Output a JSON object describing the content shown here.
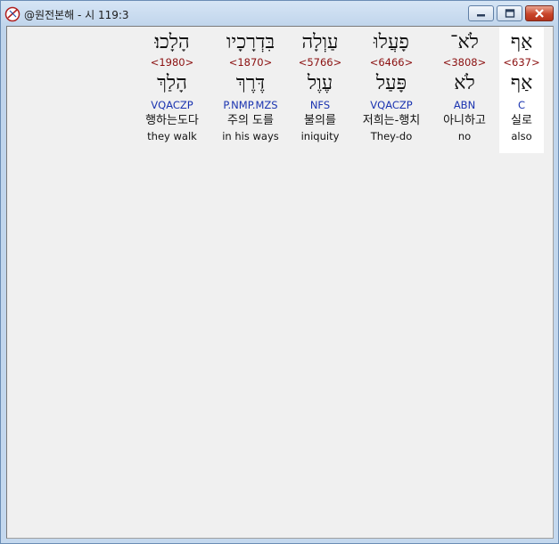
{
  "window": {
    "title": "@원전본해 - 시 119:3",
    "minimize_icon": "minimize-icon",
    "maximize_icon": "maximize-icon",
    "close_icon": "close-icon"
  },
  "words": [
    {
      "hebrew": "אַף",
      "strong": "<637>",
      "lemma": "אַף",
      "morph": "C",
      "korean": "실로",
      "english": "also",
      "selected": true
    },
    {
      "hebrew": "לֹא־",
      "strong": "<3808>",
      "lemma": "לֹא",
      "morph": "ABN",
      "korean": "아니하고",
      "english": "no",
      "selected": false
    },
    {
      "hebrew": "פָעֲלוּ",
      "strong": "<6466>",
      "lemma": "פָּעַל",
      "morph": "VQACZP",
      "korean": "저희는-행치",
      "english": "They-do",
      "selected": false
    },
    {
      "hebrew": "עַוְלָה",
      "strong": "<5766>",
      "lemma": "עֶוֶל",
      "morph": "NFS",
      "korean": "불의를",
      "english": "iniquity",
      "selected": false
    },
    {
      "hebrew": "בִּדְרָכָיו",
      "strong": "<1870>",
      "lemma": "דֶּרֶךְ",
      "morph": "P.NMP.MZS",
      "korean": "주의 도를",
      "english": "in his ways",
      "selected": false
    },
    {
      "hebrew": "הָלָכוּ׃",
      "strong": "<1980>",
      "lemma": "הָלַךְ",
      "morph": "VQACZP",
      "korean": "행하는도다",
      "english": "they walk",
      "selected": false
    }
  ]
}
